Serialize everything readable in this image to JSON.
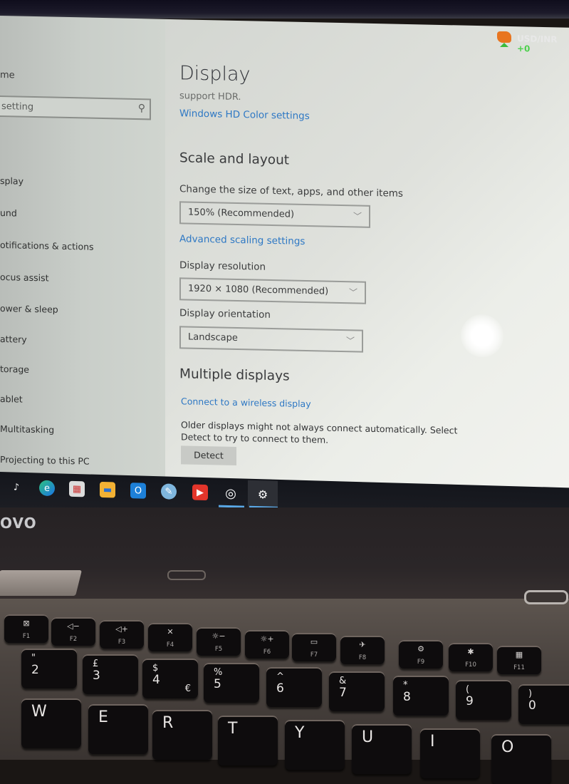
{
  "settings": {
    "sidebar": {
      "home_label": "me",
      "search_placeholder": "setting",
      "search_icon": "search-icon",
      "items": [
        {
          "label": "splay"
        },
        {
          "label": "und"
        },
        {
          "label": "otifications & actions"
        },
        {
          "label": "ocus assist"
        },
        {
          "label": "ower & sleep"
        },
        {
          "label": "attery"
        },
        {
          "label": "torage"
        },
        {
          "label": "ablet"
        },
        {
          "label": "Multitasking"
        },
        {
          "label": "Projecting to this PC"
        }
      ]
    },
    "main": {
      "title": "Display",
      "hdr_text": "support HDR.",
      "hdr_link": "Windows HD Color settings",
      "scale_section": {
        "heading": "Scale and layout",
        "size_label": "Change the size of text, apps, and other items",
        "size_value": "150% (Recommended)",
        "advanced_link": "Advanced scaling settings",
        "resolution_label": "Display resolution",
        "resolution_value": "1920 × 1080 (Recommended)",
        "orientation_label": "Display orientation",
        "orientation_value": "Landscape"
      },
      "multiple_section": {
        "heading": "Multiple displays",
        "wireless_link": "Connect to a wireless display",
        "description": "Older displays might not always connect automatically. Select Detect to try to connect to them.",
        "detect_button": "Detect"
      }
    }
  },
  "taskbar": {
    "apps": [
      {
        "name": "tiktok",
        "glyph": "♪"
      },
      {
        "name": "edge",
        "glyph": "e"
      },
      {
        "name": "store",
        "glyph": "▦"
      },
      {
        "name": "file-explorer",
        "glyph": "▬"
      },
      {
        "name": "outlook",
        "glyph": "O"
      },
      {
        "name": "paint",
        "glyph": "✎"
      },
      {
        "name": "youtube",
        "glyph": "▶"
      },
      {
        "name": "cortana",
        "glyph": "◎"
      },
      {
        "name": "settings",
        "glyph": "⚙"
      }
    ],
    "widget_text": "USD/INR",
    "widget_change": "+0"
  },
  "laptop": {
    "brand": "OVO",
    "fkeys": [
      {
        "icon": "⊠",
        "label": "F1"
      },
      {
        "icon": "◁−",
        "label": "F2"
      },
      {
        "icon": "◁+",
        "label": "F3"
      },
      {
        "icon": "✕",
        "label": "F4"
      },
      {
        "icon": "☼−",
        "label": "F5"
      },
      {
        "icon": "☼+",
        "label": "F6"
      },
      {
        "icon": "▭",
        "label": "F7"
      },
      {
        "icon": "✈",
        "label": "F8"
      },
      {
        "icon": "⚙",
        "label": "F9"
      },
      {
        "icon": "✱",
        "label": "F10"
      },
      {
        "icon": "▦",
        "label": "F11"
      }
    ],
    "number_keys": [
      {
        "top": "\"",
        "bottom": "2",
        "alt": ""
      },
      {
        "top": "£",
        "bottom": "3",
        "alt": ""
      },
      {
        "top": "$",
        "bottom": "4",
        "alt": "€"
      },
      {
        "top": "%",
        "bottom": "5",
        "alt": ""
      },
      {
        "top": "^",
        "bottom": "6",
        "alt": ""
      },
      {
        "top": "&",
        "bottom": "7",
        "alt": ""
      },
      {
        "top": "*",
        "bottom": "8",
        "alt": ""
      },
      {
        "top": "(",
        "bottom": "9",
        "alt": ""
      },
      {
        "top": ")",
        "bottom": "0",
        "alt": ""
      }
    ],
    "letter_keys": [
      "W",
      "E",
      "R",
      "T",
      "Y",
      "U",
      "I",
      "O"
    ]
  }
}
